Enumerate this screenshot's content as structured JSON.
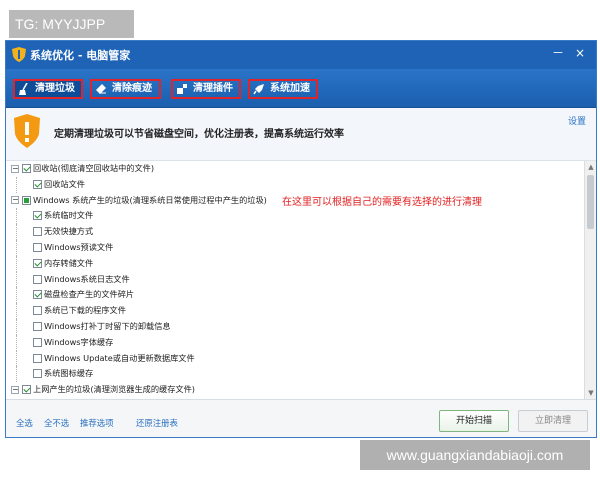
{
  "tag": "TG: MYYJJPP",
  "window": {
    "title": "系统优化 - 电脑管家",
    "minimize": "－",
    "close": "×"
  },
  "tabs": [
    {
      "label": "清理垃圾",
      "icon": "broom-icon"
    },
    {
      "label": "清除痕迹",
      "icon": "eraser-icon"
    },
    {
      "label": "清理插件",
      "icon": "plugin-icon"
    },
    {
      "label": "系统加速",
      "icon": "rocket-icon"
    }
  ],
  "banner": {
    "text": "定期清理垃圾可以节省磁盘空间，优化注册表，提高系统运行效率",
    "settings": "设置"
  },
  "tree": [
    {
      "level": 0,
      "expander": "⊟",
      "state": "checked",
      "label": "回收站(彻底清空回收站中的文件)"
    },
    {
      "level": 1,
      "state": "checked",
      "label": "回收站文件"
    },
    {
      "level": 0,
      "expander": "⊟",
      "state": "partial",
      "label": "Windows 系统产生的垃圾(清理系统日常使用过程中产生的垃圾)"
    },
    {
      "level": 1,
      "state": "checked",
      "label": "系统临时文件"
    },
    {
      "level": 1,
      "state": "unchecked",
      "label": "无效快捷方式"
    },
    {
      "level": 1,
      "state": "unchecked",
      "label": "Windows预读文件"
    },
    {
      "level": 1,
      "state": "checked",
      "label": "内存转储文件"
    },
    {
      "level": 1,
      "state": "unchecked",
      "label": "Windows系统日志文件"
    },
    {
      "level": 1,
      "state": "checked",
      "label": "磁盘检查产生的文件碎片"
    },
    {
      "level": 1,
      "state": "unchecked",
      "label": "系统已下载的程序文件"
    },
    {
      "level": 1,
      "state": "unchecked",
      "label": "Windows打补丁时留下的卸载信息"
    },
    {
      "level": 1,
      "state": "unchecked",
      "label": "Windows字体缓存"
    },
    {
      "level": 1,
      "state": "unchecked",
      "label": "Windows Update或自动更新数据库文件"
    },
    {
      "level": 1,
      "state": "unchecked",
      "label": "系统图标缓存"
    },
    {
      "level": 0,
      "expander": "⊟",
      "state": "checked",
      "label": "上网产生的垃圾(清理浏览器生成的缓存文件)"
    }
  ],
  "annotation": "在这里可以根据自己的需要有选择的进行清理",
  "footer": {
    "links": [
      "全选",
      "全不选",
      "推荐选项",
      "还原注册表"
    ],
    "scan_button": "开始扫描",
    "clean_button": "立即清理"
  },
  "watermark": "www.guangxiandabiaoji.com",
  "colors": {
    "titlebar": "#1e63b6",
    "highlight_border": "#e0242b",
    "annotation": "#e02020"
  }
}
